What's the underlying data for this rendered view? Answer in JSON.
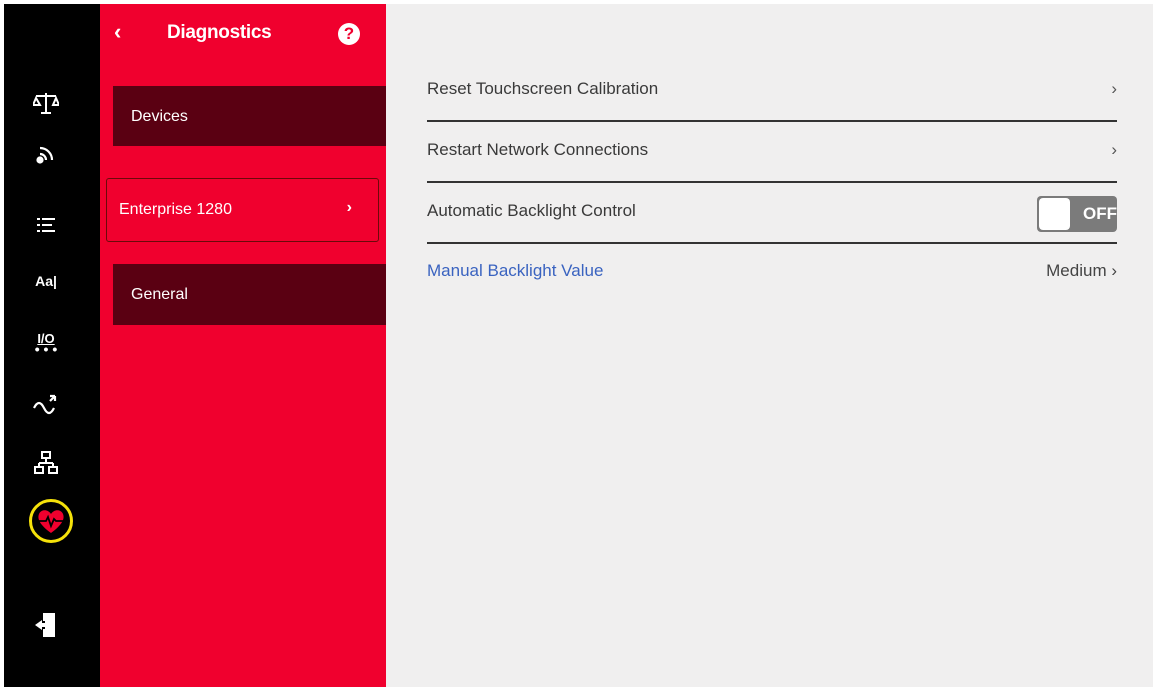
{
  "sidebar": {
    "icons": [
      {
        "name": "scale-icon"
      },
      {
        "name": "wireless-icon"
      },
      {
        "name": "list-icon"
      },
      {
        "name": "font-icon",
        "text": "Aa|"
      },
      {
        "name": "io-icon",
        "text": "I/O"
      },
      {
        "name": "signal-flow-icon"
      },
      {
        "name": "network-icon"
      },
      {
        "name": "diagnostics-heart-icon"
      },
      {
        "name": "logout-icon"
      }
    ],
    "highlight_color": "#f5e20a"
  },
  "submenu": {
    "title": "Diagnostics",
    "back_icon": "chevron-left-icon",
    "help_symbol": "?",
    "items": [
      {
        "label": "Devices"
      },
      {
        "label": "Enterprise 1280",
        "selected": true
      },
      {
        "label": "General"
      }
    ]
  },
  "content": {
    "rows": [
      {
        "label": "Reset Touchscreen Calibration",
        "chevron": "›"
      },
      {
        "label": "Restart Network Connections",
        "chevron": "›"
      },
      {
        "label": "Automatic Backlight Control",
        "toggle": "OFF"
      },
      {
        "label": "Manual Backlight Value",
        "value": "Medium ›"
      }
    ]
  },
  "colors": {
    "accent": "#f0002e",
    "dark_item": "#5a0012",
    "link": "#3a63c0",
    "content_bg": "#f0efef"
  }
}
